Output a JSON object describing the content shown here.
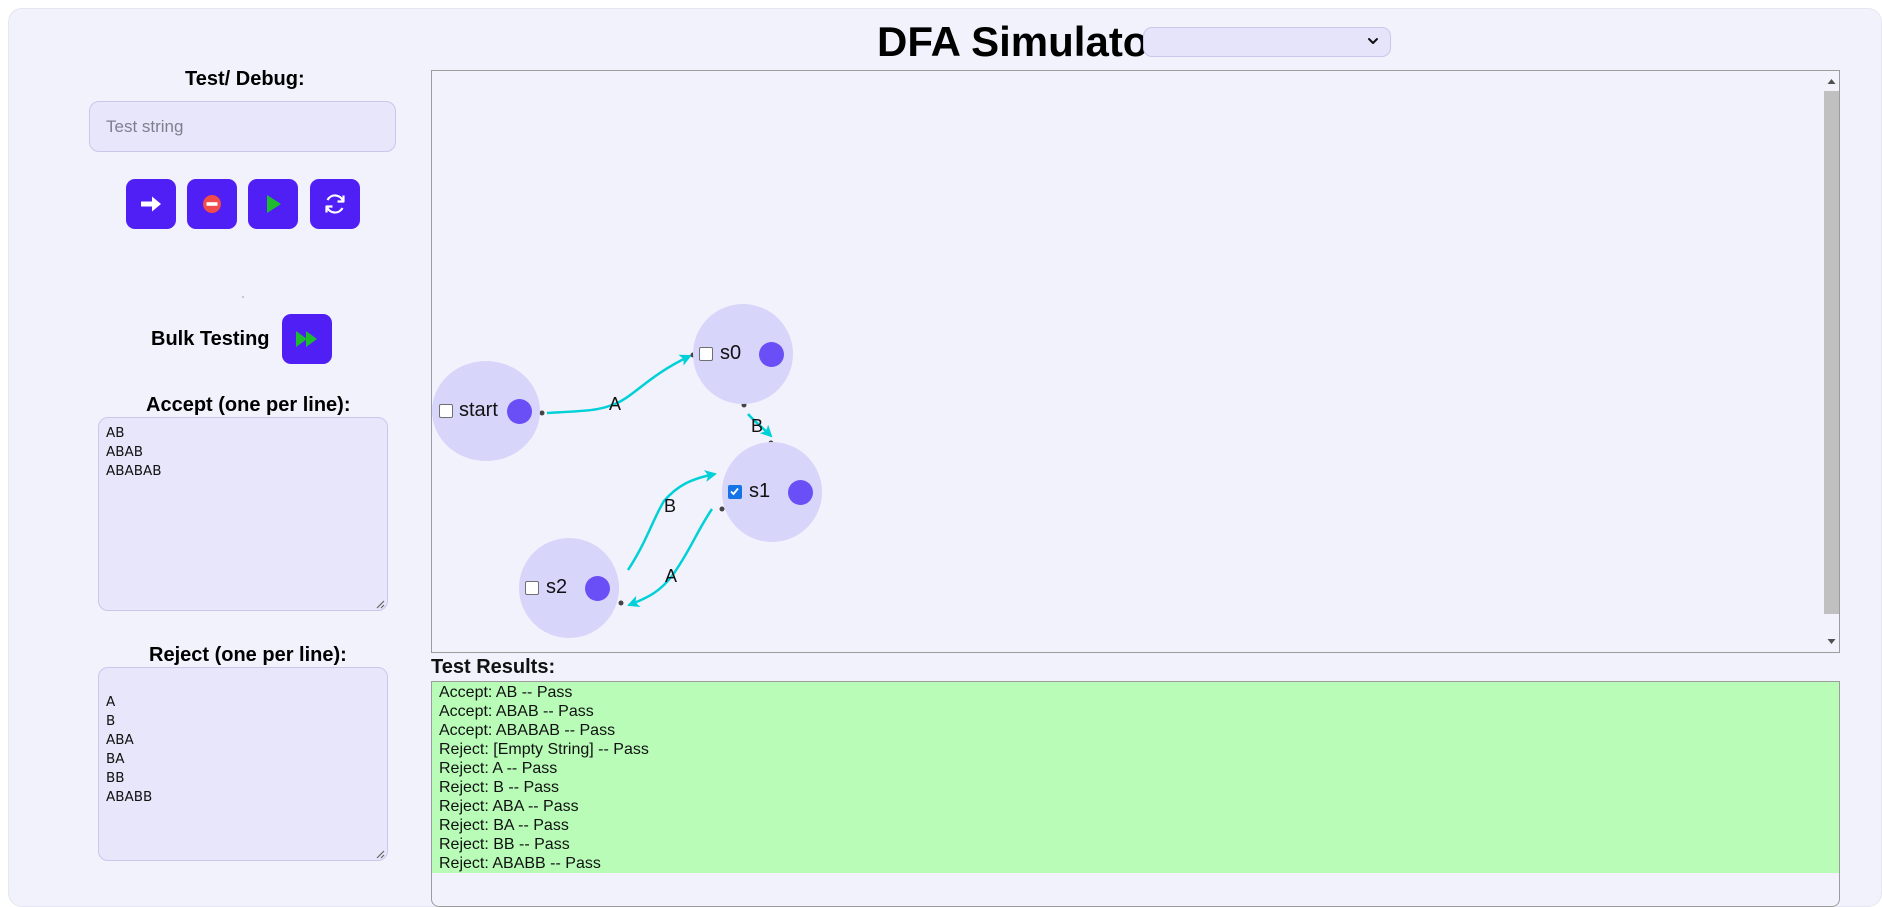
{
  "app": {
    "title": "DFA Simulator",
    "machine_select_value": ""
  },
  "test_debug": {
    "label": "Test/ Debug:",
    "input_placeholder": "Test string",
    "input_value": "",
    "buttons": [
      {
        "name": "step-button",
        "icon": "arrow-right-icon"
      },
      {
        "name": "stop-button",
        "icon": "stop-icon"
      },
      {
        "name": "run-button",
        "icon": "play-icon"
      },
      {
        "name": "reset-button",
        "icon": "refresh-icon"
      }
    ]
  },
  "bulk": {
    "label": "Bulk Testing",
    "button_icon": "fast-forward-icon"
  },
  "accept": {
    "label": "Accept (one per line):",
    "text": "AB\nABAB\nABABAB"
  },
  "reject": {
    "label": "Reject (one per line):",
    "text": "\nA\nB\nABA\nBA\nBB\nABABB"
  },
  "dfa": {
    "states": [
      {
        "id": "start",
        "label": "start",
        "accepting": false
      },
      {
        "id": "s0",
        "label": "s0",
        "accepting": false
      },
      {
        "id": "s1",
        "label": "s1",
        "accepting": true
      },
      {
        "id": "s2",
        "label": "s2",
        "accepting": false
      }
    ],
    "transitions": [
      {
        "from": "start",
        "to": "s0",
        "label": "A"
      },
      {
        "from": "s0",
        "to": "s1",
        "label": "B"
      },
      {
        "from": "s2",
        "to": "s1",
        "label": "B"
      },
      {
        "from": "s1",
        "to": "s2",
        "label": "A"
      }
    ]
  },
  "results": {
    "label": "Test Results:",
    "lines": [
      "Accept: AB -- Pass",
      "Accept: ABAB -- Pass",
      "Accept: ABABAB -- Pass",
      "Reject: [Empty String] -- Pass",
      "Reject: A -- Pass",
      "Reject: B -- Pass",
      "Reject: ABA -- Pass",
      "Reject: BA -- Pass",
      "Reject: BB -- Pass",
      "Reject: ABABB -- Pass"
    ]
  },
  "colors": {
    "accent": "#4f1ff5",
    "state_fill": "#d7d5fa",
    "state_handle": "#6a4ef6",
    "edge": "#00d0d8",
    "pass_bg": "#b8fcb8",
    "background": "#f2f2fd"
  }
}
